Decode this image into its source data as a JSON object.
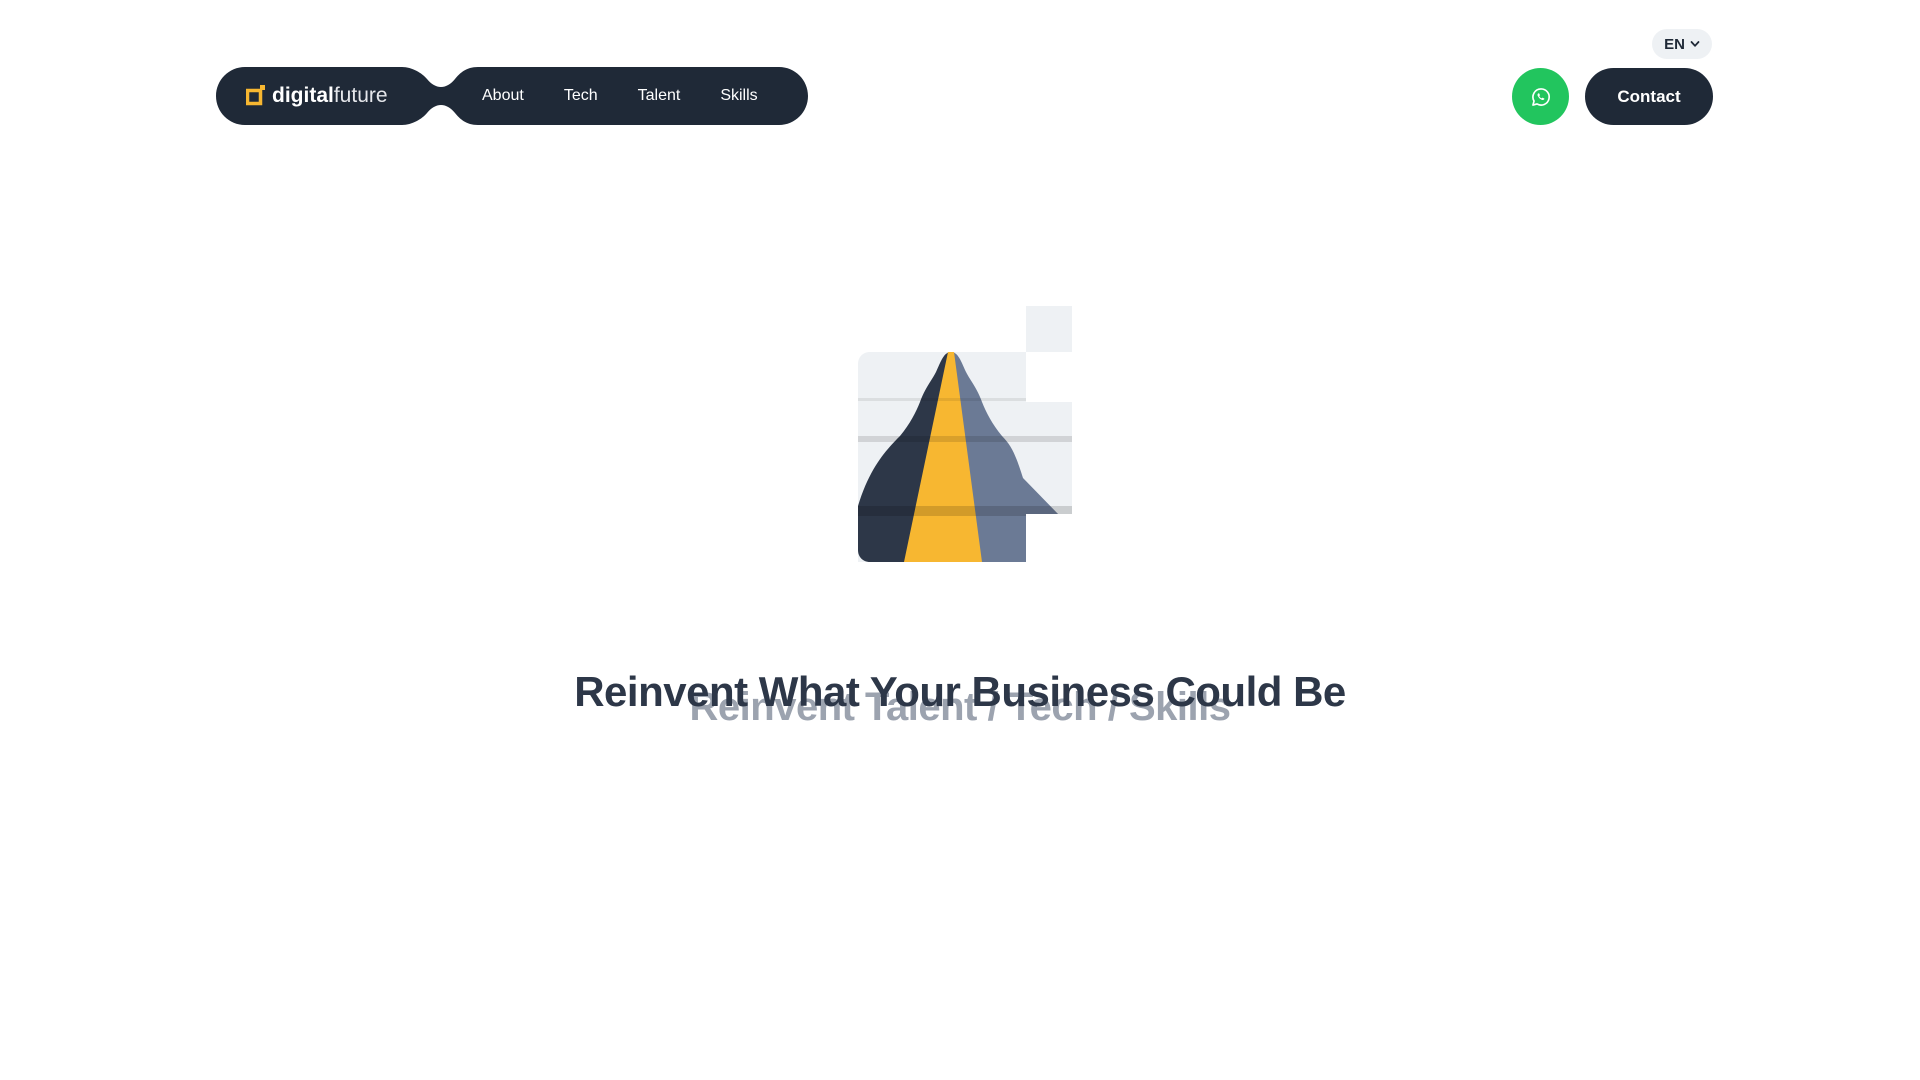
{
  "language": {
    "current": "EN",
    "icon": "chevron-down-icon"
  },
  "logo": {
    "part_bold": "digital",
    "part_light": "future",
    "icon": "logo-mark-icon",
    "accent": "#F7B731"
  },
  "nav": {
    "items": [
      {
        "label": "About"
      },
      {
        "label": "Tech"
      },
      {
        "label": "Talent"
      },
      {
        "label": "Skills"
      }
    ]
  },
  "actions": {
    "whatsapp_icon": "whatsapp-icon",
    "contact_label": "Contact"
  },
  "hero": {
    "art_icon": "road-mountain-illustration",
    "headline": "Reinvent What Your Business Could Be",
    "subline": "Reinvent Talent / Tech / Skills"
  },
  "colors": {
    "navy": "#1F2937",
    "accent_yellow": "#F7B731",
    "whatsapp_green": "#22C55E",
    "muted_gray": "#9CA3AF"
  }
}
